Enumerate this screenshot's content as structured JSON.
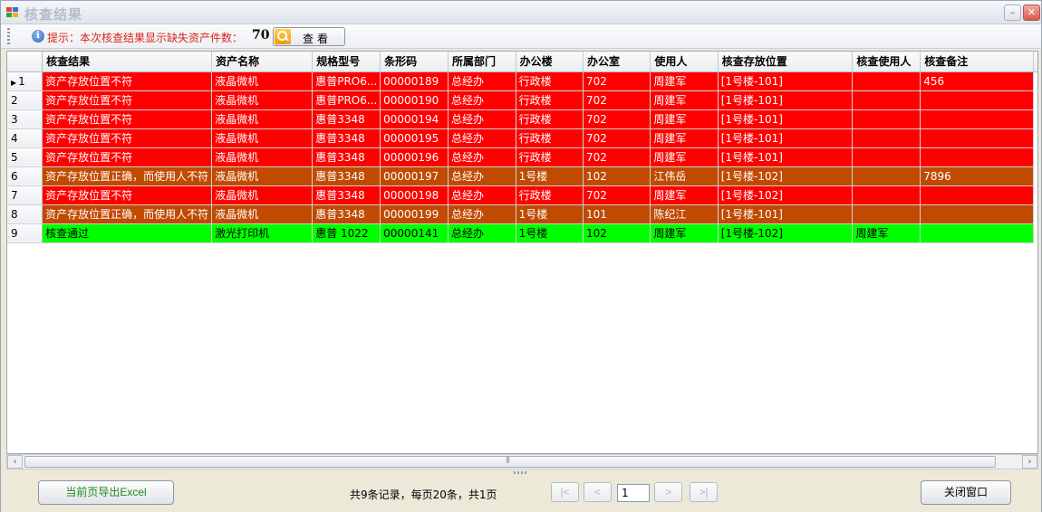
{
  "window": {
    "title": "核查结果"
  },
  "toolbar": {
    "hint": "提示：本次核查结果显示缺失资产件数：",
    "missing_count": "70",
    "view_label": "查看"
  },
  "table": {
    "columns": [
      "核查结果",
      "资产名称",
      "规格型号",
      "条形码",
      "所属部门",
      "办公楼",
      "办公室",
      "使用人",
      "核查存放位置",
      "核查使用人",
      "核查备注"
    ],
    "rows": [
      {
        "num": "1",
        "status": "red",
        "cells": [
          "资产存放位置不符",
          "液晶微机",
          "惠普PRO6...",
          "00000189",
          "总经办",
          "行政楼",
          "702",
          "周建军",
          "[1号楼-101]",
          "",
          "456"
        ]
      },
      {
        "num": "2",
        "status": "red",
        "cells": [
          "资产存放位置不符",
          "液晶微机",
          "惠普PRO6...",
          "00000190",
          "总经办",
          "行政楼",
          "702",
          "周建军",
          "[1号楼-101]",
          "",
          ""
        ]
      },
      {
        "num": "3",
        "status": "red",
        "cells": [
          "资产存放位置不符",
          "液晶微机",
          "惠普3348",
          "00000194",
          "总经办",
          "行政楼",
          "702",
          "周建军",
          "[1号楼-101]",
          "",
          ""
        ]
      },
      {
        "num": "4",
        "status": "red",
        "cells": [
          "资产存放位置不符",
          "液晶微机",
          "惠普3348",
          "00000195",
          "总经办",
          "行政楼",
          "702",
          "周建军",
          "[1号楼-101]",
          "",
          ""
        ]
      },
      {
        "num": "5",
        "status": "red",
        "cells": [
          "资产存放位置不符",
          "液晶微机",
          "惠普3348",
          "00000196",
          "总经办",
          "行政楼",
          "702",
          "周建军",
          "[1号楼-101]",
          "",
          ""
        ]
      },
      {
        "num": "6",
        "status": "brown",
        "cells": [
          "资产存放位置正确，而使用人不符",
          "液晶微机",
          "惠普3348",
          "00000197",
          "总经办",
          "1号楼",
          "102",
          "江伟岳",
          "[1号楼-102]",
          "",
          "7896"
        ]
      },
      {
        "num": "7",
        "status": "red",
        "cells": [
          "资产存放位置不符",
          "液晶微机",
          "惠普3348",
          "00000198",
          "总经办",
          "行政楼",
          "702",
          "周建军",
          "[1号楼-102]",
          "",
          ""
        ]
      },
      {
        "num": "8",
        "status": "brown",
        "cells": [
          "资产存放位置正确，而使用人不符",
          "液晶微机",
          "惠普3348",
          "00000199",
          "总经办",
          "1号楼",
          "101",
          "陈纪江",
          "[1号楼-101]",
          "",
          ""
        ]
      },
      {
        "num": "9",
        "status": "green",
        "cells": [
          "核查通过",
          "激光打印机",
          "惠普 1022",
          "00000141",
          "总经办",
          "1号楼",
          "102",
          "周建军",
          "[1号楼-102]",
          "周建军",
          ""
        ]
      }
    ]
  },
  "footer": {
    "export_label": "当前页导出Excel",
    "pager_info": "共9条记录，每页20条，共1页",
    "first_label": "|<",
    "prev_label": "<",
    "page_value": "1",
    "next_label": ">",
    "last_label": ">|",
    "close_label": "关闭窗口"
  },
  "colors": {
    "mismatch_row": "#ff0000",
    "user_mismatch_row": "#c04a00",
    "passed_row": "#00ff00",
    "hint_text": "#d8241c",
    "export_text": "#1f8a1f"
  }
}
